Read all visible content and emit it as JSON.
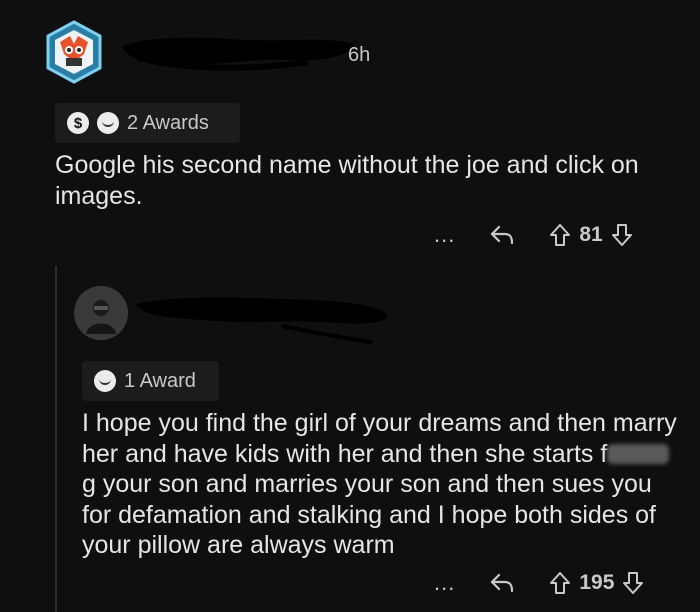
{
  "comment": {
    "time": "6h",
    "awards_label": "2 Awards",
    "body": "Google his second name without the joe and click on images.",
    "votes": "81",
    "more": "..."
  },
  "reply": {
    "awards_label": "1 Award",
    "body_part1": "I hope you find the girl of your dreams and then marry her and have kids with her and then she starts f",
    "body_part2": "g your son and marries your son and then sues you for defamation and stalking and I hope both sides of your pillow are always warm",
    "votes": "195",
    "more": "..."
  },
  "colors": {
    "background": "#0f0f10",
    "text": "#e4e6e8",
    "muted": "#c9c9c9",
    "award_bg": "#1c1c1e"
  },
  "icons": [
    "avatar",
    "dollar-award-icon",
    "wholesome-award-icon",
    "more-icon",
    "reply-icon",
    "upvote-icon",
    "downvote-icon"
  ]
}
